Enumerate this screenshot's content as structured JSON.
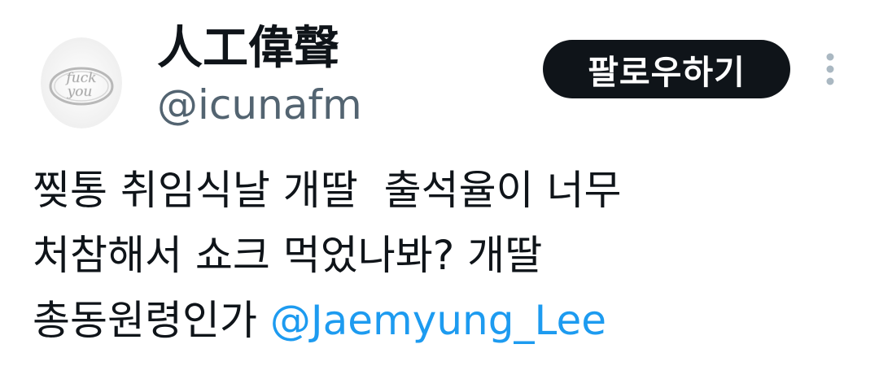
{
  "author": {
    "display_name": "人工偉聲",
    "handle": "@icunafm",
    "avatar_text": "fuck you"
  },
  "actions": {
    "follow_label": "팔로우하기",
    "more_icon": "more-vertical-icon"
  },
  "tweet": {
    "lines": [
      "찢통 취임식날 개딸  출석율이 너무",
      "처참해서 쇼크 먹었나봐? 개딸",
      "총동원령인가 "
    ],
    "mention": "@Jaemyung_Lee"
  },
  "colors": {
    "text_primary": "#0f1419",
    "text_secondary": "#536471",
    "accent": "#1d9bf0",
    "button_bg": "#0f1419",
    "button_text": "#ffffff"
  }
}
